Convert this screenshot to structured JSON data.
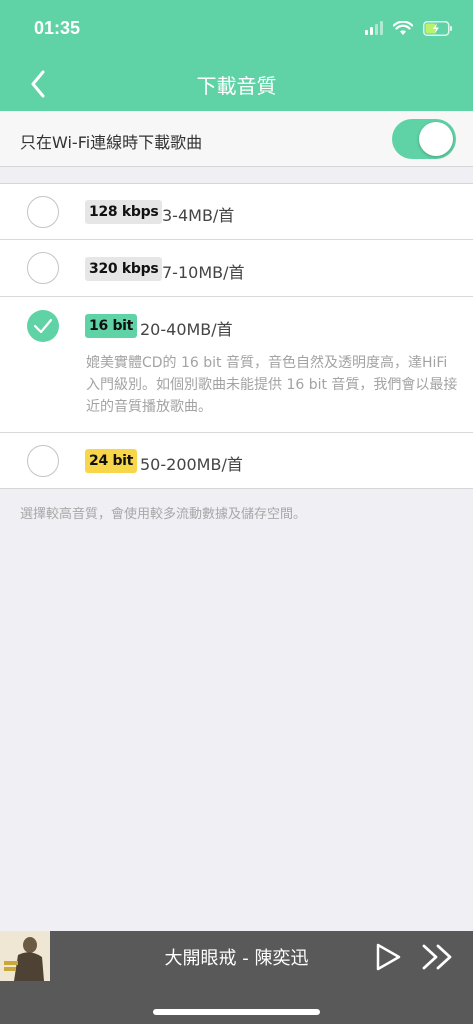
{
  "status_bar": {
    "time": "01:35",
    "icons": [
      "signal-icon",
      "wifi-icon",
      "battery-charging-icon"
    ]
  },
  "nav": {
    "title": "下載音質",
    "back_icon": "chevron-left-icon"
  },
  "wifi_only": {
    "label": "只在Wi-Fi連線時下載歌曲",
    "enabled": true
  },
  "quality_options": [
    {
      "badge": "128 kbps",
      "badge_color": "#e6e6e6",
      "size": "3-4MB/首",
      "selected": false
    },
    {
      "badge": "320 kbps",
      "badge_color": "#e6e6e6",
      "size": "7-10MB/首",
      "selected": false
    },
    {
      "badge": "16 bit",
      "badge_color": "#5fd3a6",
      "size": "20-40MB/首",
      "selected": true,
      "description": "媲美實體CD的 16 bit 音質，音色自然及透明度高，達HiFi入門級別。如個別歌曲未能提供 16 bit 音質，我們會以最接近的音質播放歌曲。"
    },
    {
      "badge": "24 bit",
      "badge_color": "#f7d64a",
      "size": "50-200MB/首",
      "selected": false
    }
  ],
  "footer_note": "選擇較高音質，會使用較多流動數據及儲存空間。",
  "player": {
    "track": "大開眼戒 - 陳奕迅",
    "play_icon": "play-icon",
    "next_icon": "fast-forward-icon"
  },
  "colors": {
    "accent": "#5fd3a6",
    "player_bg": "#595959",
    "badge_yellow": "#f7d64a"
  }
}
